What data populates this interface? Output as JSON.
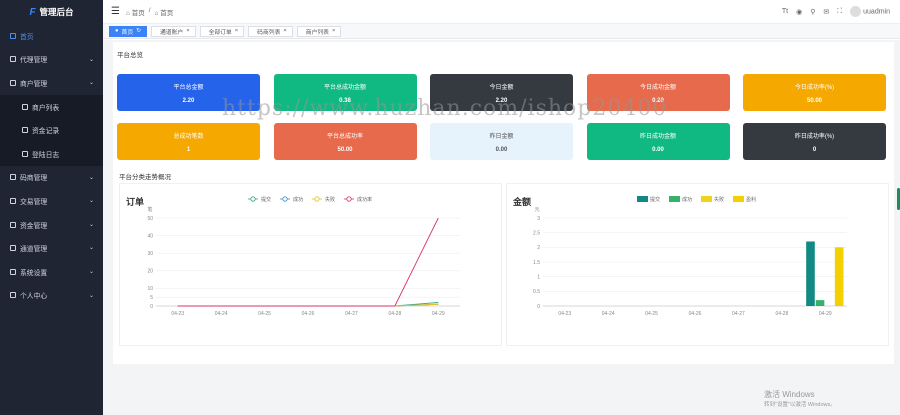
{
  "app": {
    "logo_mark": "F",
    "title": "管理后台"
  },
  "sidebar": {
    "items": [
      {
        "label": "首页",
        "active": true,
        "sub": false,
        "chevron": false
      },
      {
        "label": "代理管理",
        "active": false,
        "sub": false,
        "chevron": true
      },
      {
        "label": "商户管理",
        "active": false,
        "sub": false,
        "chevron": true
      },
      {
        "label": "商户列表",
        "active": false,
        "sub": true,
        "chevron": false
      },
      {
        "label": "资金记录",
        "active": false,
        "sub": true,
        "chevron": false
      },
      {
        "label": "登陆日志",
        "active": false,
        "sub": true,
        "chevron": false
      },
      {
        "label": "码商管理",
        "active": false,
        "sub": false,
        "chevron": true
      },
      {
        "label": "交易管理",
        "active": false,
        "sub": false,
        "chevron": true
      },
      {
        "label": "资金管理",
        "active": false,
        "sub": false,
        "chevron": true
      },
      {
        "label": "通道管理",
        "active": false,
        "sub": false,
        "chevron": true
      },
      {
        "label": "系统设置",
        "active": false,
        "sub": false,
        "chevron": true
      },
      {
        "label": "个人中心",
        "active": false,
        "sub": false,
        "chevron": true
      }
    ]
  },
  "topbar": {
    "breadcrumb": [
      "首页",
      "/",
      "首页"
    ],
    "user": "uuadmin"
  },
  "tabs": [
    "首页",
    "通道账户",
    "全部订单",
    "码商列表",
    "商户列表"
  ],
  "overview": {
    "title": "平台总览",
    "cards": [
      {
        "label": "平台总金额",
        "value": "2.20",
        "color": "#2563eb",
        "text": "#ffffff"
      },
      {
        "label": "平台总成功金额",
        "value": "0.38",
        "color": "#10b981",
        "text": "#ffffff"
      },
      {
        "label": "今日金额",
        "value": "2.20",
        "color": "#343a40",
        "text": "#ffffff"
      },
      {
        "label": "今日成功金额",
        "value": "0.20",
        "color": "#e76a4c",
        "text": "#ffffff"
      },
      {
        "label": "今日成功率(%)",
        "value": "50.00",
        "color": "#f5a800",
        "text": "#ffffff"
      },
      {
        "label": "总成功笔数",
        "value": "1",
        "color": "#f5a800",
        "text": "#ffffff"
      },
      {
        "label": "平台总成功率",
        "value": "50.00",
        "color": "#e76a4c",
        "text": "#ffffff"
      },
      {
        "label": "昨日金额",
        "value": "0.00",
        "color": "#e6f3fc",
        "text": "#555555"
      },
      {
        "label": "昨日成功金额",
        "value": "0.00",
        "color": "#10b981",
        "text": "#ffffff"
      },
      {
        "label": "昨日成功率(%)",
        "value": "0",
        "color": "#343a40",
        "text": "#ffffff"
      }
    ]
  },
  "charts_section": {
    "title": "平台分类走势概况"
  },
  "chart_data": [
    {
      "type": "line",
      "title": "订单",
      "ylabel": "笔",
      "x": [
        "04-23",
        "04-24",
        "04-25",
        "04-26",
        "04-27",
        "04-28",
        "04-29"
      ],
      "ylim": [
        0,
        50
      ],
      "yticks": [
        0,
        5,
        10,
        20,
        30,
        40,
        50
      ],
      "series": [
        {
          "name": "提交",
          "color": "#2fa77a",
          "values": [
            0,
            0,
            0,
            0,
            0,
            0,
            2
          ]
        },
        {
          "name": "成功",
          "color": "#3b8fd1",
          "values": [
            0,
            0,
            0,
            0,
            0,
            0,
            1
          ]
        },
        {
          "name": "失败",
          "color": "#e6c323",
          "values": [
            0,
            0,
            0,
            0,
            0,
            0,
            1
          ]
        },
        {
          "name": "成功率",
          "color": "#d6336c",
          "values": [
            0,
            0,
            0,
            0,
            0,
            0,
            50
          ]
        }
      ]
    },
    {
      "type": "bar",
      "title": "金额",
      "ylabel": "元",
      "x": [
        "04-23",
        "04-24",
        "04-25",
        "04-26",
        "04-27",
        "04-28",
        "04-29"
      ],
      "ylim": [
        0,
        3
      ],
      "yticks": [
        0,
        0.5,
        1,
        1.5,
        2,
        2.5,
        3
      ],
      "series": [
        {
          "name": "提交",
          "color": "#118a84",
          "values": [
            0,
            0,
            0,
            0,
            0,
            0,
            2.2
          ]
        },
        {
          "name": "成功",
          "color": "#39b06a",
          "values": [
            0,
            0,
            0,
            0,
            0,
            0,
            0.2
          ]
        },
        {
          "name": "失败",
          "color": "#f2d31b",
          "values": [
            0,
            0,
            0,
            0,
            0,
            0,
            0
          ]
        },
        {
          "name": "盈利",
          "color": "#f5d000",
          "values": [
            0,
            0,
            0,
            0,
            0,
            0,
            2.0
          ]
        }
      ]
    }
  ],
  "watermark": "https://www.huzhan.com/ishop20400",
  "windows": {
    "line1": "激活 Windows",
    "line2": "转到\"设置\"以激活 Windows。"
  }
}
